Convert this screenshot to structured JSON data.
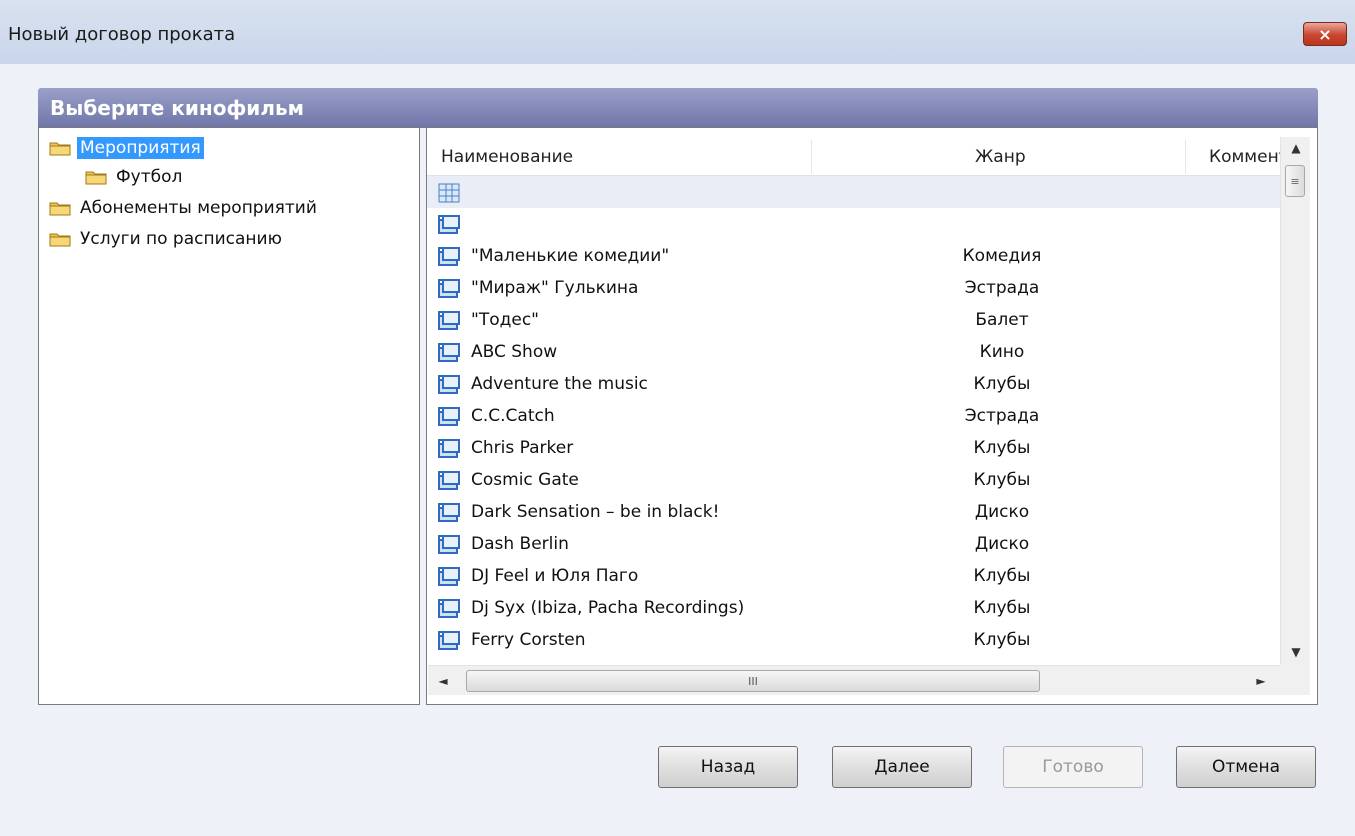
{
  "window": {
    "title": "Новый договор проката",
    "close_glyph": "×"
  },
  "group": {
    "header": "Выберите кинофильм"
  },
  "tree": {
    "items": [
      {
        "label": "Мероприятия",
        "selected": true,
        "icon": "folder-icon"
      },
      {
        "label": "Футбол",
        "selected": false,
        "icon": "folder-icon"
      },
      {
        "label": "Абонементы мероприятий",
        "selected": false,
        "icon": "folder-icon"
      },
      {
        "label": "Услуги по расписанию",
        "selected": false,
        "icon": "folder-icon"
      }
    ]
  },
  "list": {
    "columns": [
      "Наименование",
      "Жанр",
      "Коммент"
    ],
    "rows": [
      {
        "name": "",
        "genre": "",
        "icon": "new-row-icon"
      },
      {
        "name": "",
        "genre": "",
        "icon": "film-icon"
      },
      {
        "name": "\"Маленькие комедии\"",
        "genre": "Комедия",
        "icon": "film-icon"
      },
      {
        "name": "\"Мираж\" Гулькина",
        "genre": "Эстрада",
        "icon": "film-icon"
      },
      {
        "name": "\"Тодес\"",
        "genre": "Балет",
        "icon": "film-icon"
      },
      {
        "name": "ABC Show",
        "genre": "Кино",
        "icon": "film-icon"
      },
      {
        "name": "Adventure the music",
        "genre": "Клубы",
        "icon": "film-icon"
      },
      {
        "name": "C.C.Catch",
        "genre": "Эстрада",
        "icon": "film-icon"
      },
      {
        "name": "Chris Parker",
        "genre": "Клубы",
        "icon": "film-icon"
      },
      {
        "name": "Cosmic Gate",
        "genre": "Клубы",
        "icon": "film-icon"
      },
      {
        "name": "Dark Sensation – be in black!",
        "genre": "Диско",
        "icon": "film-icon"
      },
      {
        "name": "Dash Berlin",
        "genre": "Диско",
        "icon": "film-icon"
      },
      {
        "name": "DJ Feel и Юля Паго",
        "genre": "Клубы",
        "icon": "film-icon"
      },
      {
        "name": "Dj Syx (Ibiza, Pacha Recordings)",
        "genre": "Клубы",
        "icon": "film-icon"
      },
      {
        "name": "Ferry Corsten",
        "genre": "Клубы",
        "icon": "film-icon"
      }
    ]
  },
  "scrollbar": {
    "up_glyph": "▲",
    "down_glyph": "▼",
    "left_glyph": "◄",
    "right_glyph": "►",
    "thumb_grip_v": "≡",
    "thumb_grip_h": "III"
  },
  "buttons": {
    "back": "Назад",
    "next": "Далее",
    "done": "Готово",
    "cancel": "Отмена"
  }
}
